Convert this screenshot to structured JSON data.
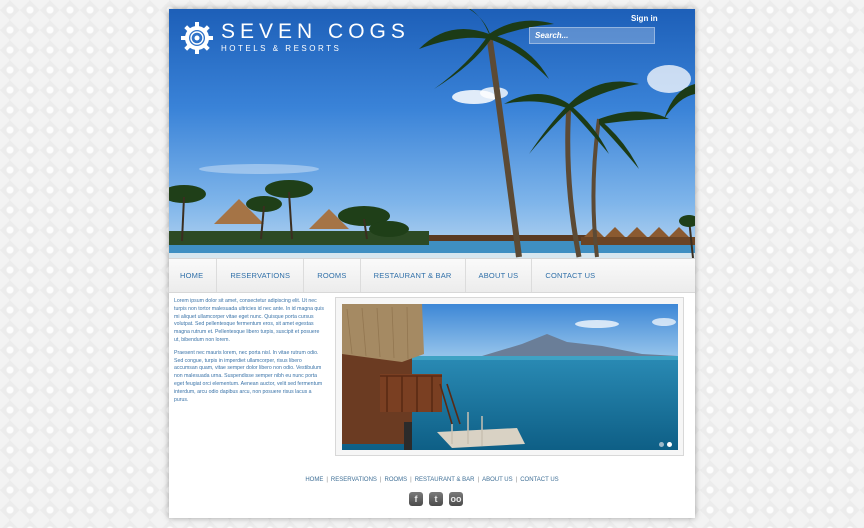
{
  "brand": {
    "name": "SEVEN COGS",
    "tagline": "HOTELS & RESORTS"
  },
  "header": {
    "signin_label": "Sign in",
    "search_placeholder": "Search..."
  },
  "nav": {
    "items": [
      {
        "label": "HOME"
      },
      {
        "label": "RESERVATIONS"
      },
      {
        "label": "ROOMS"
      },
      {
        "label": "RESTAURANT & BAR"
      },
      {
        "label": "ABOUT US"
      },
      {
        "label": "CONTACT US"
      }
    ]
  },
  "content": {
    "paragraphs": [
      "Lorem ipsum dolor sit amet, consectetur adipiscing elit. Ut nec turpis non tortor malesuada ultricies id nec ante. In id magna quis mi aliquet ullamcorper vitae eget nunc. Quisque porta cursus volutpat. Sed pellentesque fermentum eros, sit amet egestas magna rutrum et. Pellentesque libero turpis, suscipit et posuere ut, bibendum non lorem.",
      "Praesent nec mauris lorem, nec porta nisl. In vitae rutrum odio. Sed congue, turpis in imperdiet ullamcorper, risus libero accumsan quam, vitae semper dolor libero non odio. Vestibulum non malesuada urna. Suspendisse semper nibh eu nunc porta eget feugiat orci elementum. Aenean auctor, velit sed fermentum interdum, arcu odio dapibus arcu, non posuere risus lacus a purus."
    ]
  },
  "slider": {
    "slide_count": 2,
    "active_index": 1
  },
  "footer": {
    "links": [
      {
        "label": "HOME"
      },
      {
        "label": "RESERVATIONS"
      },
      {
        "label": "ROOMS"
      },
      {
        "label": "RESTAURANT & BAR"
      },
      {
        "label": "ABOUT US"
      },
      {
        "label": "CONTACT US"
      }
    ],
    "social": [
      {
        "icon": "facebook-icon",
        "glyph": "f"
      },
      {
        "icon": "twitter-icon",
        "glyph": "t"
      },
      {
        "icon": "tripadvisor-icon",
        "glyph": "oo"
      }
    ]
  },
  "colors": {
    "link": "#2f6fa8",
    "body_text": "#3a73a8",
    "sky": "#2f78d0",
    "sea": "#1d7fa3"
  }
}
